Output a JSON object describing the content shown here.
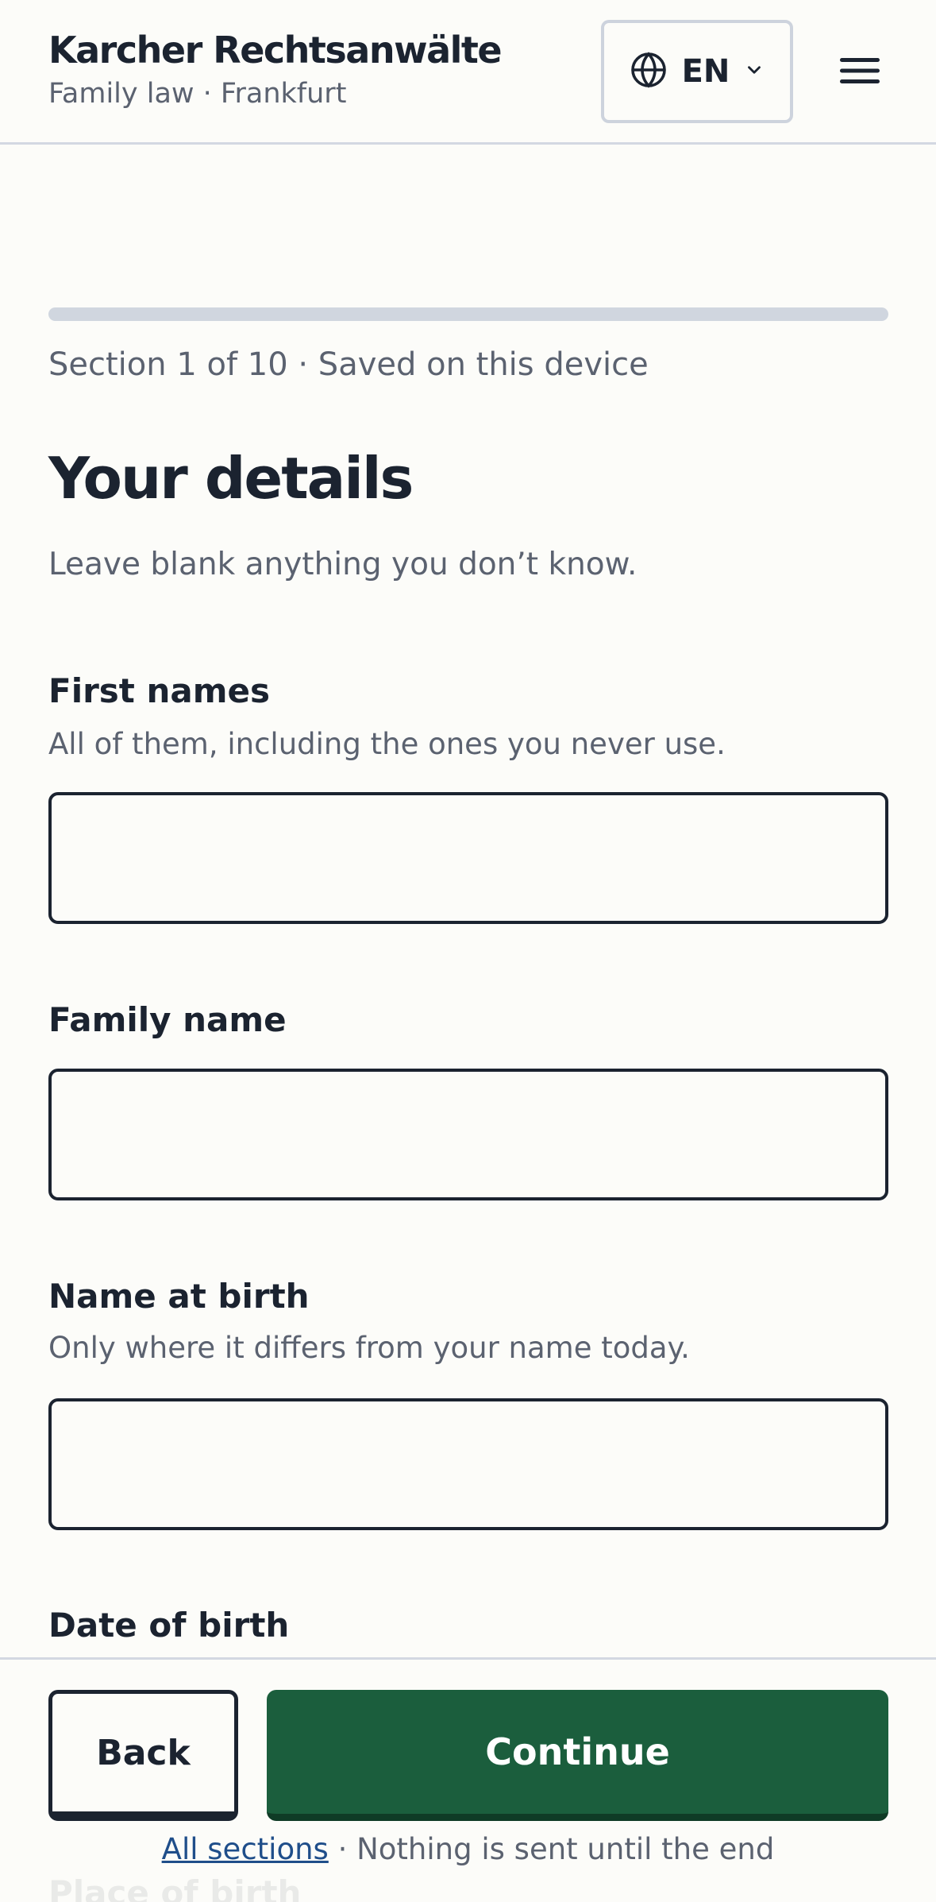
{
  "header": {
    "brand_name": "Karcher Rechtsanwälte",
    "brand_sub": "Family law · Frankfurt",
    "language": "EN"
  },
  "progress": {
    "text": "Section 1 of 10 · Saved on this device",
    "fraction": 0
  },
  "page": {
    "title": "Your details",
    "intro": "Leave blank anything you don’t know."
  },
  "fields": [
    {
      "label": "First names",
      "hint": "All of them, including the ones you never use.",
      "value": ""
    },
    {
      "label": "Family name",
      "hint": "",
      "value": ""
    },
    {
      "label": "Name at birth",
      "hint": "Only where it differs from your name today.",
      "value": ""
    },
    {
      "label": "Date of birth"
    },
    {
      "label": "Place of birth"
    }
  ],
  "footer": {
    "back_label": "Back",
    "continue_label": "Continue",
    "all_sections_link": "All sections",
    "note": " · Nothing is sent until the end"
  },
  "colors": {
    "accent": "#1b5e3d",
    "text": "#1b2330",
    "muted": "#5b6270",
    "link": "#1f4e8a"
  }
}
